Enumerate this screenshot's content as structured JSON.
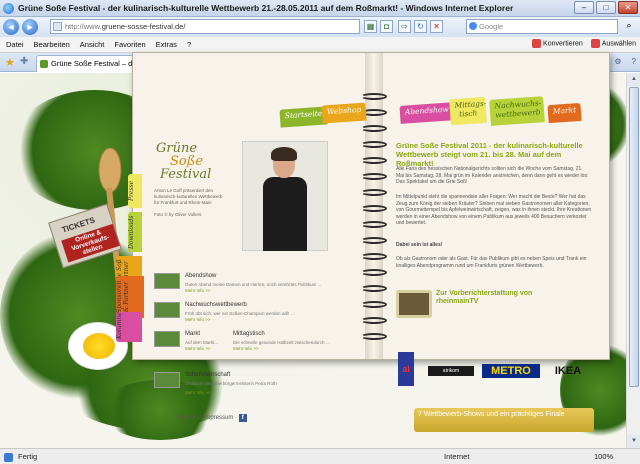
{
  "window": {
    "title": "Grüne Soße Festival - der kulinarisch-kulturelle Wettbewerb 21.-28.05.2011 auf dem Roßmarkt! - Windows Internet Explorer",
    "min": "–",
    "max": "□",
    "close": "✕"
  },
  "address": {
    "url_prefix": "http://www.",
    "url_main": "gruene-sosse-festival.de/",
    "search_placeholder": "Google"
  },
  "menu": {
    "items": [
      "Datei",
      "Bearbeiten",
      "Ansicht",
      "Favoriten",
      "Extras",
      "?"
    ],
    "convert": "Konvertieren",
    "select": "Auswählen"
  },
  "tab": {
    "label": "Grüne Soße Festival – der kulinarisch-kulturelle Wettb..."
  },
  "site": {
    "nav": [
      "Startseite",
      "Webshop",
      "Abendshow",
      "Mittags-tisch",
      "Nachwuchs-wettbewerb",
      "Markt"
    ],
    "side": [
      "Presse",
      "Downloads",
      "Grie Soß Partner",
      "Sponsoren & Partner",
      "Kolumne"
    ],
    "logo": {
      "l1": "Grüne",
      "l2": "Soße",
      "l3": "Festival"
    },
    "intro": [
      "Anton Le Goff präsentiert den",
      "kulinarisch-kulturellen Wettbewerb",
      "für Frankfurt und Rhein-Main"
    ],
    "photo_credit": "Foto © by Oliver Vollers",
    "tickets": {
      "title": "TICKETS",
      "sub": "Online & Vorverkaufs-stellen"
    },
    "entries": [
      {
        "title": "Abendshow",
        "sub": "Guten Abend meine Damen und Herren, noch verehrtes Publikum ...",
        "more": "Mehr Info >>"
      },
      {
        "title": "Nachwuchswettbewerb",
        "sub": "Früh übt sich, wer ein Soßen-Champion werden will! ...",
        "more": "Mehr Info >>"
      },
      {
        "title": "Markt",
        "sub": "Auf dem Markt...",
        "more": "Mehr Info >>"
      },
      {
        "title": "Mittagstisch",
        "sub": "Die schnelle gesunde Halbzeit zwischendurch ...",
        "more": "Mehr Info >>"
      },
      {
        "title": "Schirmherrschaft",
        "sub": "Grußwort der Oberbürgermeisterin Petra Roth",
        "more": "Mehr Info >>"
      }
    ],
    "kontakt": "Kontakt · Impressum ·",
    "headline": "Grüne Soße Festival 2011 - der kulinarisch-kulturelle Wettbewerb steigt vom 21. bis 28. Mai auf dem Roßmarkt!",
    "paragraphs": [
      "Alle Fans des hessischen Nationalgerichts sollten sich die Woche vom Samstag, 21. Mai bis Samstag, 28. Mai grün im Kalender anstreichen, denn dann geht es wieder los: Das Spektakel um die Grie Soß!",
      "Im Mittelpunkt steht die spannendste aller Fragen: Wer macht die Beste? Wer hat das Zeug zum König der sieben Kräuter? Sieben mal sieben Gastronomen aller Kategorien, von Gourmettempel bis Apfelweinwirtschaft, zeigen, was in ihnen steckt. Ihre Kreationen werden in einer Abendshow von einem Publikum aus jeweils 400 Besuchern verkostet und bewertet.",
      "Dabei sein ist alles!",
      "Ob als Gastronom oder als Gast. Für das Publikum gibt es neben Speis und Trank ein knalliges Abendprogramm rund um Frankfurts grünen Wettbewerb."
    ],
    "video_link": "Zur Vorberichterstattung von rheinmainTV",
    "sponsors": [
      "atrikom",
      "METRO",
      "IKEA"
    ],
    "bottom_note": "7 Wettbewerb-Shows und ein prächtiges Finale"
  },
  "status": {
    "done": "Fertig",
    "zone": "Internet",
    "zoom": "100%"
  }
}
